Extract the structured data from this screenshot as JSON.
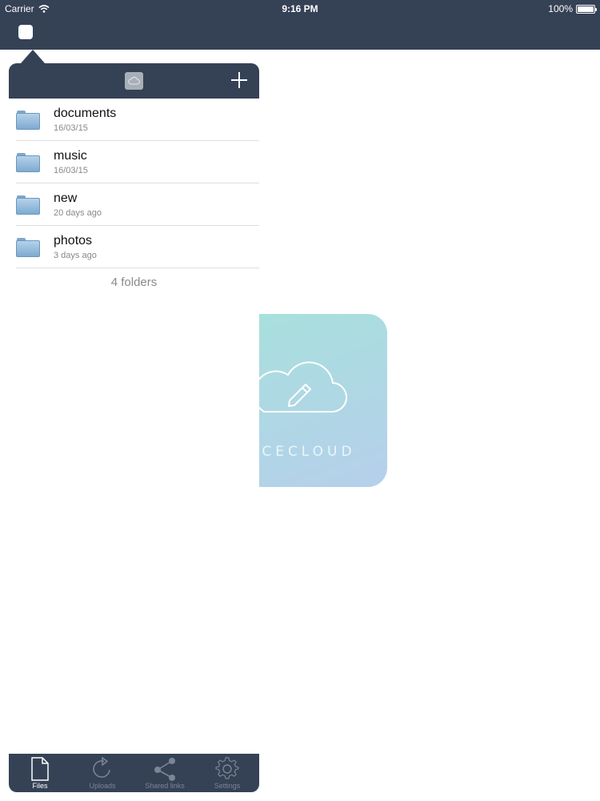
{
  "status_bar": {
    "carrier": "Carrier",
    "time": "9:16 PM",
    "battery": "100%",
    "battery_level": 1.0
  },
  "popover": {
    "header": {
      "cloud_icon": "cloud-icon",
      "add_icon": "plus-icon"
    },
    "folders": [
      {
        "name": "documents",
        "date": "16/03/15"
      },
      {
        "name": "music",
        "date": "16/03/15"
      },
      {
        "name": "new",
        "date": "20 days ago"
      },
      {
        "name": "photos",
        "date": "3 days ago"
      }
    ],
    "folder_count": "4 folders"
  },
  "tabbar": {
    "tabs": [
      {
        "label": "Files",
        "icon": "document-icon",
        "active": true
      },
      {
        "label": "Uploads",
        "icon": "refresh-icon",
        "active": false
      },
      {
        "label": "Shared links",
        "icon": "share-icon",
        "active": false
      },
      {
        "label": "Settings",
        "icon": "gear-icon",
        "active": false
      }
    ]
  },
  "splash": {
    "brand": "ACECLOUD",
    "icon": "cloud-pencil-icon"
  },
  "colors": {
    "nav": "#354155",
    "splash_start": "#a8e0dc",
    "splash_end": "#b6cfea"
  }
}
